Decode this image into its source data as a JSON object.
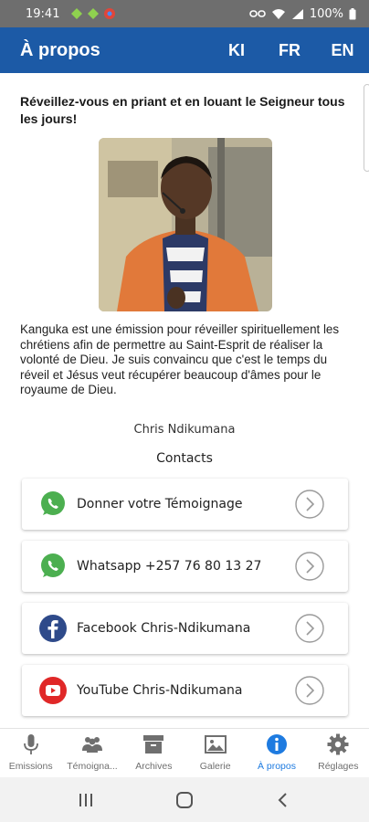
{
  "status_bar": {
    "time": "19:41",
    "battery": "100%"
  },
  "appbar": {
    "title": "À propos",
    "languages": [
      "KI",
      "FR",
      "EN"
    ]
  },
  "content": {
    "headline": "Réveillez-vous en priant et en louant le Seigneur tous les jours!",
    "body": "Kanguka est une émission pour réveiller spirituellement les chrétiens afin de permettre au Saint-Esprit de réaliser la volonté de Dieu. Je suis convaincu que c'est le temps du réveil et Jésus veut récupérer beaucoup d'âmes pour le royaume de Dieu.",
    "author": "Chris Ndikumana",
    "contacts_title": "Contacts",
    "contacts": [
      {
        "label": "Donner votre Témoignage",
        "icon": "whatsapp-icon"
      },
      {
        "label": "Whatsapp +257 76 80 13 27",
        "icon": "whatsapp-icon"
      },
      {
        "label": "Facebook Chris-Ndikumana",
        "icon": "facebook-icon"
      },
      {
        "label": "YouTube Chris-Ndikumana",
        "icon": "youtube-icon"
      }
    ]
  },
  "bottom_nav": [
    {
      "label": "Emissions",
      "icon": "microphone-icon",
      "active": false
    },
    {
      "label": "Témoigna...",
      "icon": "people-icon",
      "active": false
    },
    {
      "label": "Archives",
      "icon": "archive-icon",
      "active": false
    },
    {
      "label": "Galerie",
      "icon": "image-icon",
      "active": false
    },
    {
      "label": "À propos",
      "icon": "info-icon",
      "active": true
    },
    {
      "label": "Réglages",
      "icon": "gear-icon",
      "active": false
    }
  ],
  "colors": {
    "primary": "#1c5aa6",
    "active_nav": "#1e7be0",
    "whatsapp": "#4caf50",
    "facebook": "#2e4a8a",
    "youtube": "#e02828"
  }
}
